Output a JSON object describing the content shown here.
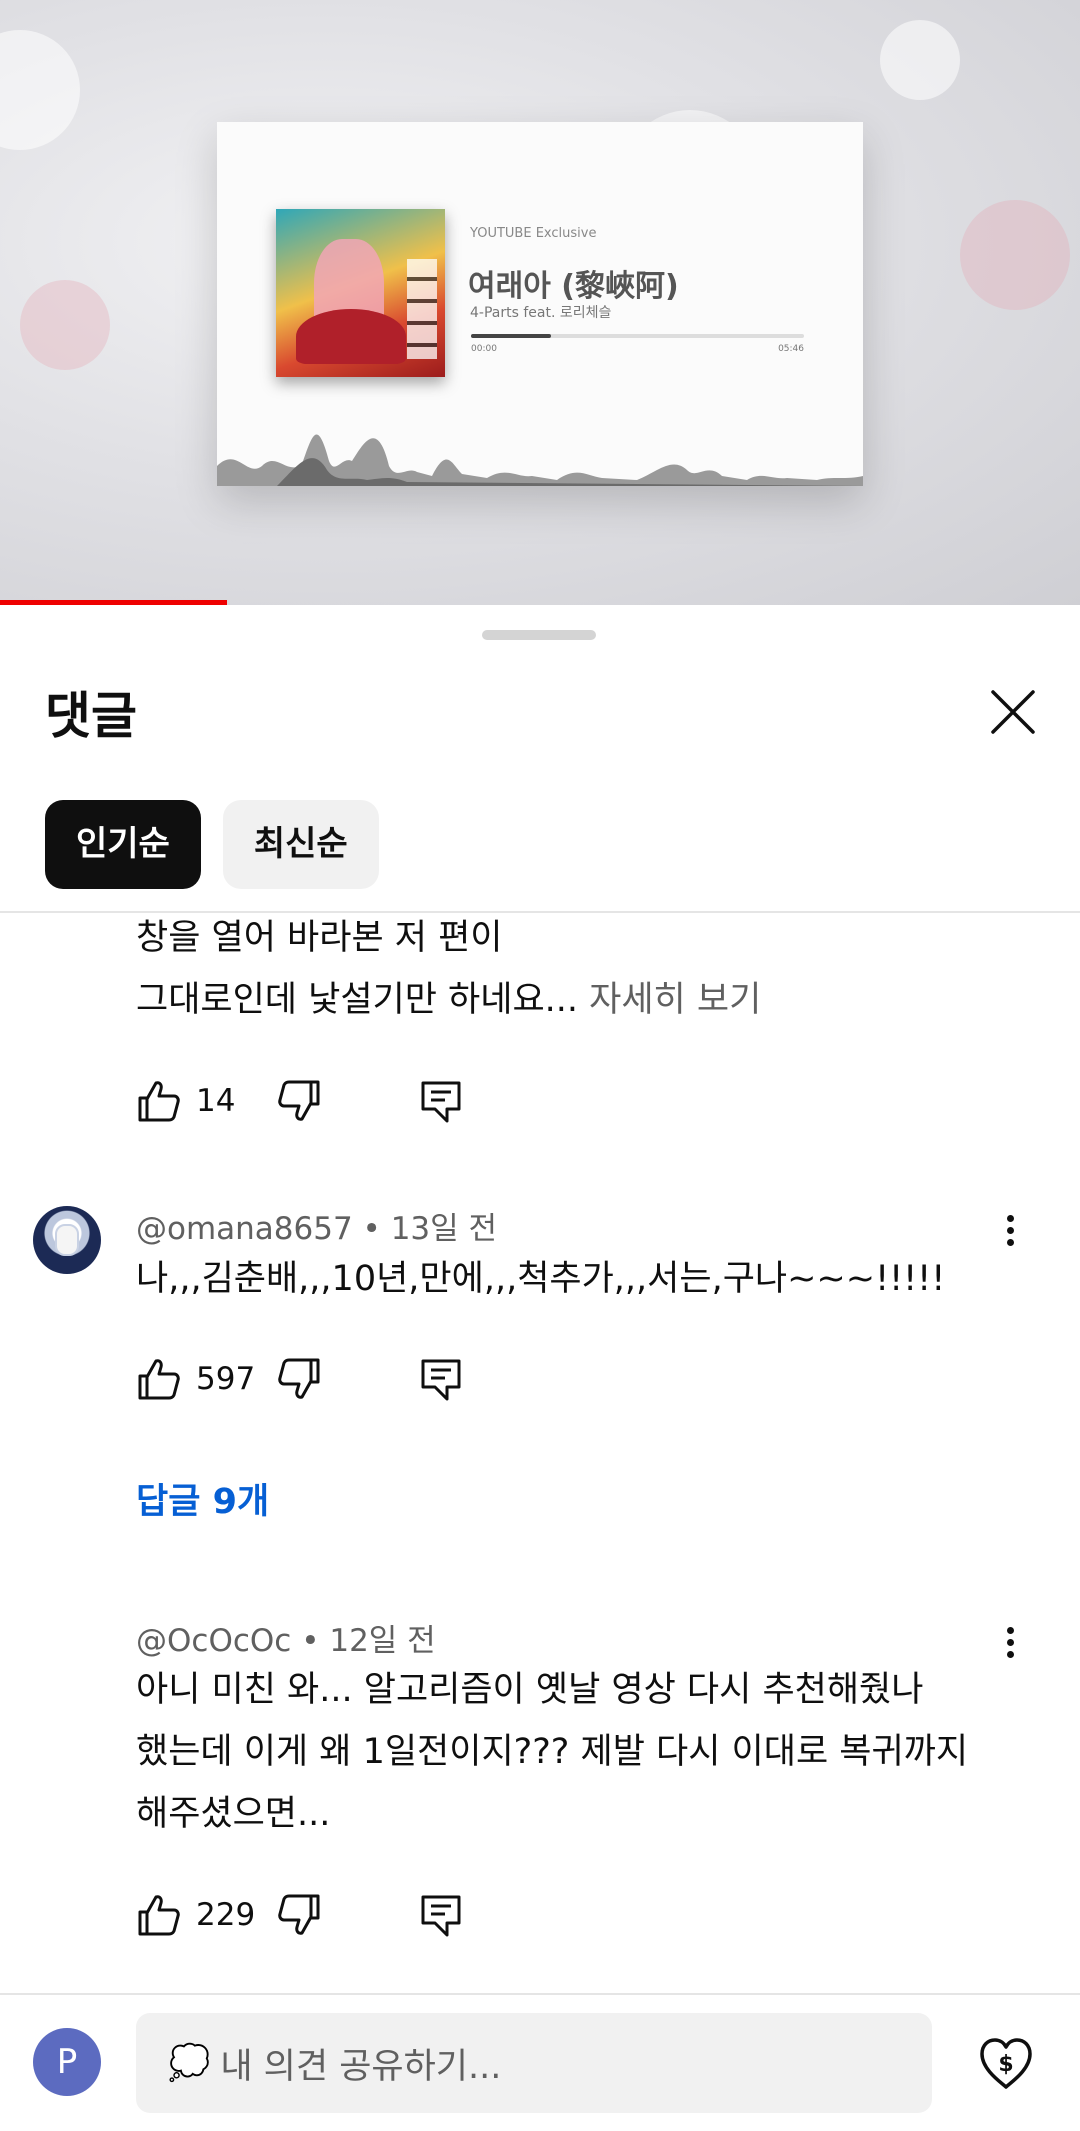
{
  "video": {
    "card_subtitle": "YOUTUBE Exclusive",
    "card_title": "여래아 (黎峽阿)",
    "card_artist": "4-Parts feat. 로리체슬",
    "time_current": "00:00",
    "time_total": "05:46",
    "track_progress": 0.24,
    "video_progress": 0.21
  },
  "sheet": {
    "title": "댓글",
    "close_icon": "close-icon",
    "chips": [
      "인기순",
      "최신순"
    ],
    "active_chip": 0
  },
  "comments": [
    {
      "lines": [
        "창을 열어 바라본 저 편이",
        "그대로인데 낯설기만 하네요... "
      ],
      "more": "자세히 보기",
      "likes": "14"
    },
    {
      "author": "@omana8657",
      "time": "13일 전",
      "text": "나,,,김춘배,,,10년,만에,,,척추가,,,서는,구나~~~!!!!!",
      "likes": "597",
      "replies": "답글 9개"
    },
    {
      "author": "@OcOcOc",
      "time": "12일 전",
      "lines": [
        "아니 미친 와... 알고리즘이 옛날 영상 다시 추천해줬나",
        "했는데 이게 왜 1일전이지??? 제발 다시 이대로 복귀까지",
        "해주셨으면..."
      ],
      "likes": "229"
    }
  ],
  "composer": {
    "avatar_letter": "P",
    "emoji": "💭",
    "placeholder": "내 의견 공유하기...",
    "thanks_icon": "heart-dollar-icon"
  },
  "colors": {
    "accent_red": "#ff0000",
    "link_blue": "#065fd4",
    "avatar_purple": "#5c6bc0"
  }
}
